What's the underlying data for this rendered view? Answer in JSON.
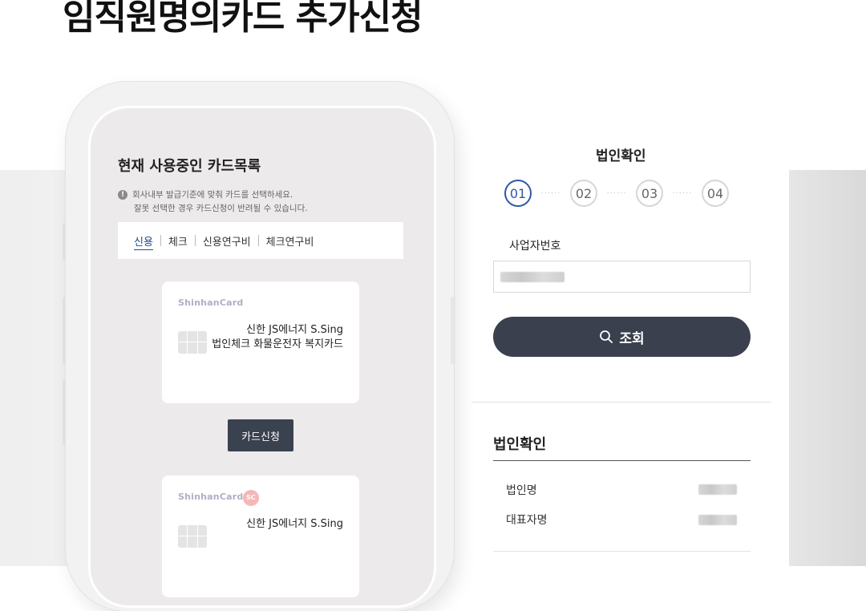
{
  "page": {
    "title": "임직원명의카드 추가신청"
  },
  "phone": {
    "screen_title": "현재 사용중인 카드목록",
    "notice": {
      "line1": "회사내부 발급기준에 맞춰 카드를 선택하세요.",
      "line2": "잘못 선택한 경우 카드신청이 반려될 수 있습니다.",
      "icon_glyph": "!"
    },
    "tabs": [
      {
        "label": "신용",
        "active": true
      },
      {
        "label": "체크",
        "active": false
      },
      {
        "label": "신용연구비",
        "active": false
      },
      {
        "label": "체크연구비",
        "active": false
      }
    ],
    "cards": [
      {
        "brand": "ShinhanCard",
        "name_line1": "신한 JS에너지 S.Sing",
        "name_line2": "법인체크 화물운전자 복지카드"
      },
      {
        "brand": "ShinhanCard",
        "name_line1": "신한 JS에너지 S.Sing",
        "name_line2": "",
        "badge": "SC"
      }
    ],
    "apply_button": "카드신청"
  },
  "panel": {
    "heading": "법인확인",
    "steps": [
      {
        "label": "01",
        "active": true
      },
      {
        "label": "02",
        "active": false
      },
      {
        "label": "03",
        "active": false
      },
      {
        "label": "04",
        "active": false
      }
    ],
    "step_separator": "······",
    "business_number_label": "사업자번호",
    "search_button": "조회",
    "result": {
      "heading": "법인확인",
      "rows": [
        {
          "label": "법인명"
        },
        {
          "label": "대표자명"
        }
      ]
    }
  },
  "colors": {
    "accent": "#2f57a5",
    "button_dark": "#3a404e",
    "tab_active": "#1d4e8f"
  }
}
